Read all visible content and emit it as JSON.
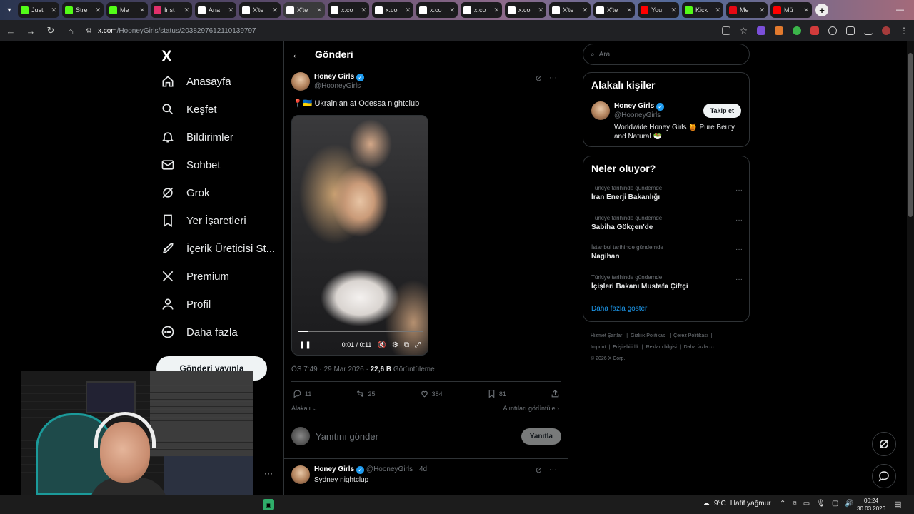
{
  "browser": {
    "tabs": [
      {
        "label": "Just",
        "color": "#53fc18"
      },
      {
        "label": "Stre",
        "color": "#53fc18"
      },
      {
        "label": "Me",
        "color": "#53fc18"
      },
      {
        "label": "Inst",
        "color": "#e1306c"
      },
      {
        "label": "Ana",
        "color": "#ffffff"
      },
      {
        "label": "X'te",
        "color": "#ffffff"
      },
      {
        "label": "X'te",
        "color": "#ffffff"
      },
      {
        "label": "x.co",
        "color": "#ffffff"
      },
      {
        "label": "x.co",
        "color": "#ffffff"
      },
      {
        "label": "x.co",
        "color": "#ffffff"
      },
      {
        "label": "x.co",
        "color": "#ffffff"
      },
      {
        "label": "x.co",
        "color": "#ffffff"
      },
      {
        "label": "X'te",
        "color": "#ffffff"
      },
      {
        "label": "X'te",
        "color": "#ffffff"
      },
      {
        "label": "You",
        "color": "#ff0000"
      },
      {
        "label": "Kick",
        "color": "#53fc18"
      },
      {
        "label": "Me",
        "color": "#e50914"
      },
      {
        "label": "Mü",
        "color": "#ff0000"
      }
    ],
    "active_tab_index": 6,
    "url_host": "x.com",
    "url_path": "/HooneyGirls/status/2038297612110139797"
  },
  "nav": {
    "logo": "X",
    "items": [
      {
        "label": "Anasayfa",
        "icon": "home-icon"
      },
      {
        "label": "Keşfet",
        "icon": "search-icon"
      },
      {
        "label": "Bildirimler",
        "icon": "bell-icon"
      },
      {
        "label": "Sohbet",
        "icon": "mail-icon"
      },
      {
        "label": "Grok",
        "icon": "grok-icon"
      },
      {
        "label": "Yer İşaretleri",
        "icon": "bookmark-icon"
      },
      {
        "label": "İçerik Üreticisi St...",
        "icon": "rocket-icon"
      },
      {
        "label": "Premium",
        "icon": "x-icon"
      },
      {
        "label": "Profil",
        "icon": "person-icon"
      },
      {
        "label": "Daha fazla",
        "icon": "more-circle-icon"
      }
    ],
    "post_button": "Gönderi yayınla"
  },
  "post": {
    "header_title": "Gönderi",
    "author_name": "Honey Girls",
    "author_handle": "@HooneyGirls",
    "text": "📍🇺🇦 Ukrainian at Odessa nightclub",
    "video_time": "0:01 / 0:11",
    "video_progress": 0.08,
    "timestamp": "ÖS 7:49 · 29 Mar 2026 · ",
    "views": "22,6 B",
    "views_label": " Görüntüleme",
    "stats": {
      "replies": "11",
      "reposts": "25",
      "likes": "384",
      "bookmarks": "81"
    },
    "related_label": "Alakalı",
    "quotes_label": "Alıntıları görüntüle",
    "reply_placeholder": "Yanıtını gönder",
    "reply_button": "Yanıtla"
  },
  "next_post": {
    "author_name": "Honey Girls",
    "author_handle": "@HooneyGirls · 4d",
    "text": "Sydney nightclup"
  },
  "sidebar": {
    "search_placeholder": "Ara",
    "who_to_follow": {
      "title": "Alakalı kişiler",
      "name": "Honey Girls",
      "handle": "@HooneyGirls",
      "follow_label": "Takip et",
      "bio": "Worldwide Honey Girls 🍯 Pure Beuty and Natural 🥗"
    },
    "trends": {
      "title": "Neler oluyor?",
      "items": [
        {
          "context": "Türkiye tarihinde gündemde",
          "name": "İran Enerji Bakanlığı"
        },
        {
          "context": "Türkiye tarihinde gündemde",
          "name": "Sabiha Gökçen'de"
        },
        {
          "context": "İstanbul tarihinde gündemde",
          "name": "Nagihan"
        },
        {
          "context": "Türkiye tarihinde gündemde",
          "name": "İçişleri Bakanı Mustafa Çiftçi"
        }
      ],
      "show_more": "Daha fazla göster"
    },
    "footer_line1": [
      "Hizmet Şartları",
      "|",
      "Gizlilik Politikası",
      "|",
      "Çerez Politikası",
      "|"
    ],
    "footer_line2": [
      "Imprint",
      "|",
      "Erişilebilirlik",
      "|",
      "Reklam bilgisi",
      "|",
      "Daha fazla ···"
    ],
    "copyright": "© 2026 X Corp."
  },
  "taskbar": {
    "weather": "9°C",
    "weather_desc": "Hafif yağmur",
    "time": "00:24",
    "date": "30.03.2026"
  }
}
